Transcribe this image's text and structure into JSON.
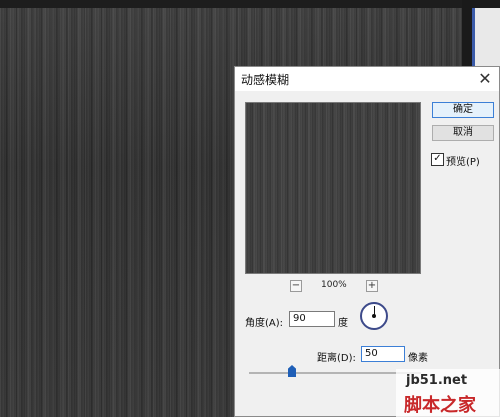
{
  "dialog": {
    "title": "动感模糊",
    "close_glyph": "✕",
    "ok_label": "确定",
    "cancel_label": "取消",
    "preview_label": "预览(P)",
    "preview_checked": true,
    "zoom_out_glyph": "−",
    "zoom_in_glyph": "+",
    "zoom_level": "100%",
    "angle_label": "角度(A):",
    "angle_value": "90",
    "angle_unit": "度",
    "distance_label": "距离(D):",
    "distance_value": "50",
    "distance_unit": "像素",
    "check_glyph": "✓",
    "distance_slider_fraction": 0.25
  },
  "watermark": {
    "url": "jb51.net",
    "name": "脚本之家"
  },
  "colors": {
    "accent": "#3c7fd6",
    "dial": "#3d4a8a",
    "slider_thumb": "#1f5fb7",
    "watermark_red": "#c8282a"
  }
}
